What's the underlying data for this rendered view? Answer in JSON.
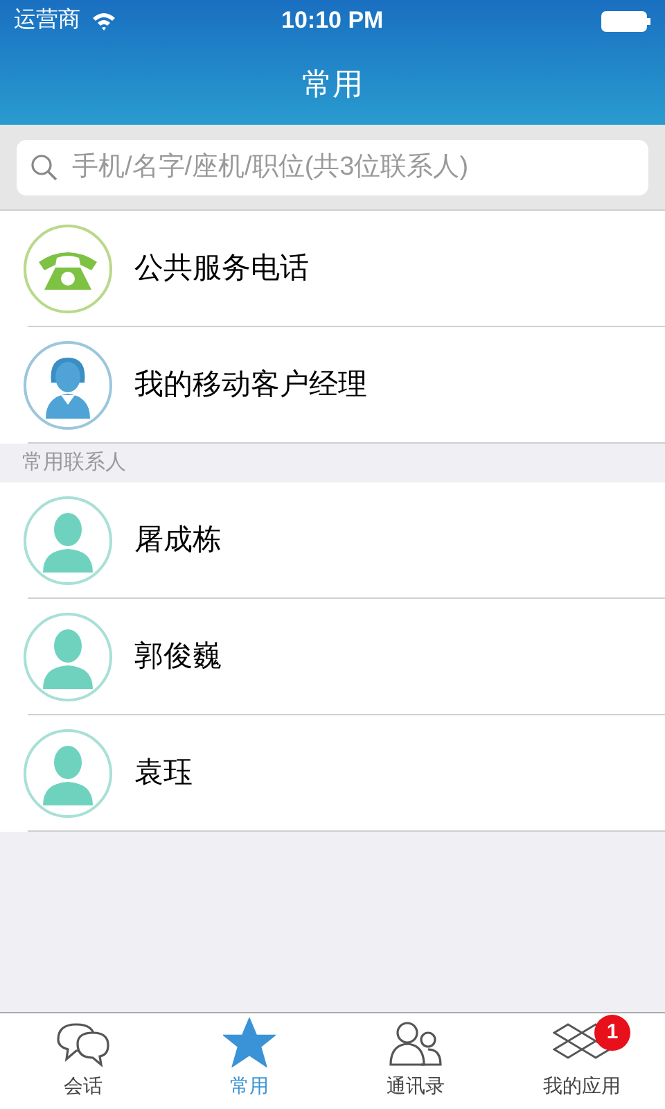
{
  "status_bar": {
    "carrier": "运营商",
    "time": "10:10 PM"
  },
  "title": "常用",
  "search": {
    "placeholder": "手机/名字/座机/职位(共3位联系人)"
  },
  "services": [
    {
      "kind": "phone",
      "name": "公共服务电话"
    },
    {
      "kind": "manager",
      "name": "我的移动客户经理"
    }
  ],
  "section_header": "常用联系人",
  "contacts": [
    {
      "name": "屠成栋"
    },
    {
      "name": "郭俊巍"
    },
    {
      "name": "袁珏"
    }
  ],
  "tabs": [
    {
      "kind": "chat",
      "label": "会话",
      "selected": false
    },
    {
      "kind": "star",
      "label": "常用",
      "selected": true
    },
    {
      "kind": "people",
      "label": "通讯录",
      "selected": false
    },
    {
      "kind": "apps",
      "label": "我的应用",
      "selected": false,
      "badge": "1"
    }
  ]
}
